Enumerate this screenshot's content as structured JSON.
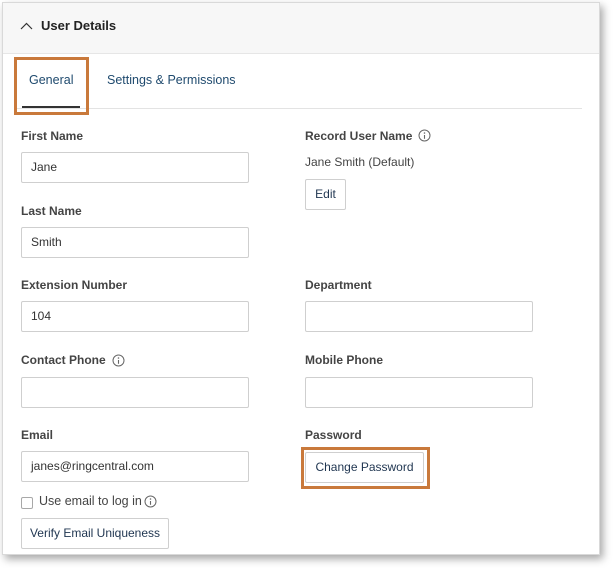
{
  "header": {
    "title": "User Details",
    "collapse_icon": "chevron-up-icon"
  },
  "tabs": [
    {
      "label": "General",
      "active": true
    },
    {
      "label": "Settings & Permissions",
      "active": false
    }
  ],
  "form": {
    "first_name": {
      "label": "First Name",
      "value": "Jane"
    },
    "last_name": {
      "label": "Last Name",
      "value": "Smith"
    },
    "extension": {
      "label": "Extension Number",
      "value": "104"
    },
    "contact_phone": {
      "label": "Contact Phone",
      "value": ""
    },
    "email": {
      "label": "Email",
      "value": "janes@ringcentral.com"
    },
    "use_email_login": {
      "label": "Use email to log in",
      "checked": false
    },
    "verify_button": "Verify Email Uniqueness",
    "record_user_name": {
      "label": "Record User Name",
      "value": "Jane Smith (Default)",
      "edit_button": "Edit"
    },
    "department": {
      "label": "Department",
      "value": ""
    },
    "mobile_phone": {
      "label": "Mobile Phone",
      "value": ""
    },
    "password": {
      "label": "Password",
      "button": "Change Password"
    }
  },
  "colors": {
    "highlight": "#c9793b",
    "link": "#1f4a6e"
  }
}
